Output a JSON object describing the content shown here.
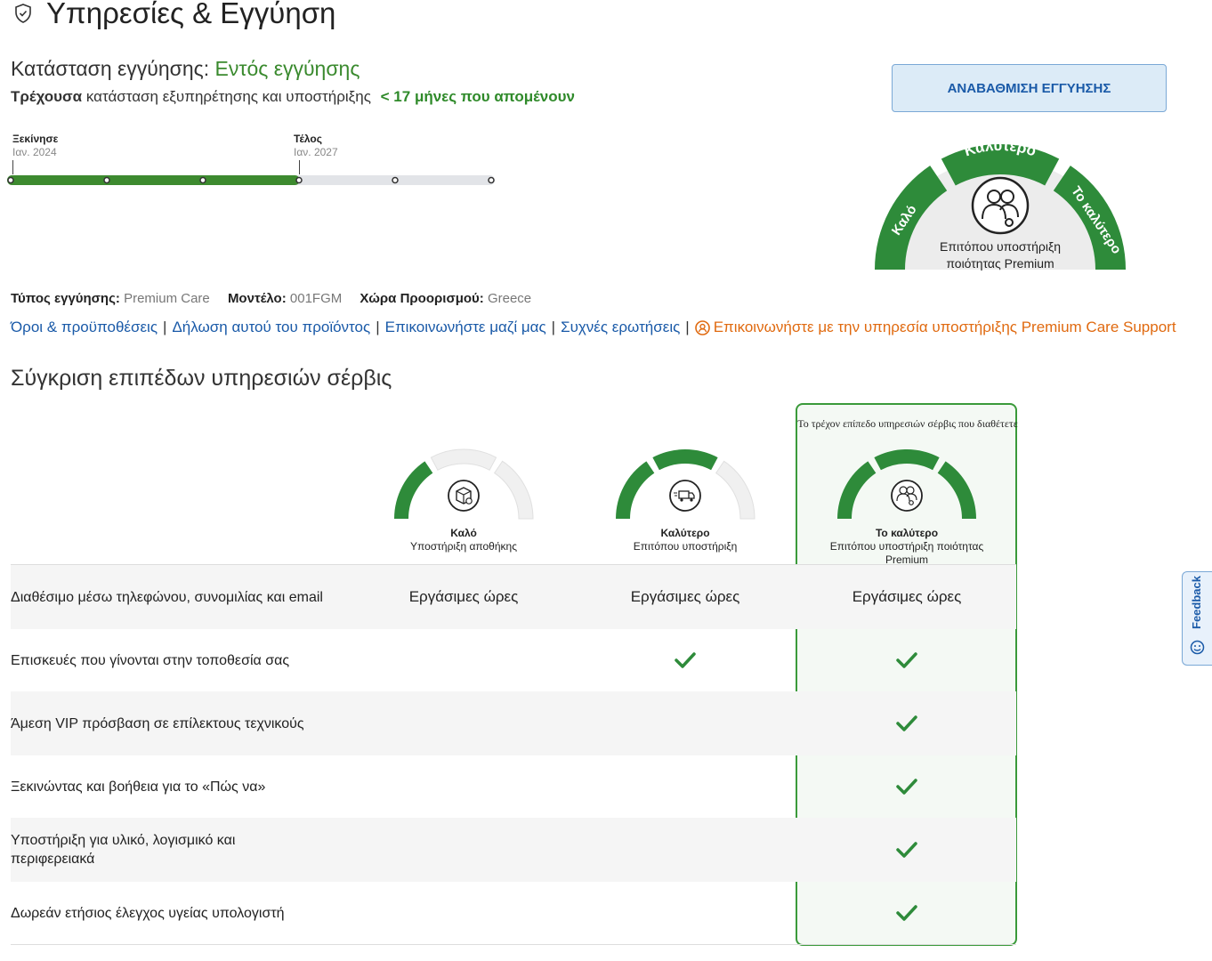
{
  "header": {
    "title": "Υπηρεσίες & Εγγύηση"
  },
  "status": {
    "label": "Κατάσταση εγγύησης:",
    "value": "Εντός εγγύησης",
    "sub_bold": "Τρέχουσα",
    "sub_rest": "κατάσταση εξυπηρέτησης και υποστήριξης",
    "remaining": "< 17 μήνες που απομένουν"
  },
  "upgrade_button": "ΑΝΑΒΑΘΜΙΣΗ ΕΓΓΥΗΣΗΣ",
  "timeline": {
    "start_label": "Ξεκίνησε",
    "start_date": "Ιαν. 2024",
    "end_label": "Τέλος",
    "end_date": "Ιαν. 2027",
    "progress_fraction": 0.6
  },
  "gauge": {
    "left": "Καλό",
    "top": "Καλύτερο",
    "right": "Το καλύτερο",
    "caption_line1": "Επιτόπου υποστήριξη",
    "caption_line2": "ποιότητας Premium",
    "active_level": 3
  },
  "info": {
    "type_label": "Τύπος εγγύησης:",
    "type_value": "Premium Care",
    "model_label": "Μοντέλο:",
    "model_value": "001FGM",
    "country_label": "Χώρα Προορισμού:",
    "country_value": "Greece"
  },
  "links": {
    "terms": "Όροι & προϋποθέσεις",
    "register": "Δήλωση αυτού του προϊόντος",
    "contact": "Επικοινωνήστε μαζί μας",
    "faq": "Συχνές ερωτήσεις",
    "premium_support": "Επικοινωνήστε με την υπηρεσία υποστήριξης Premium Care Support"
  },
  "comparison": {
    "title": "Σύγκριση επιπέδων υπηρεσιών σέρβις",
    "current_caption": "Το τρέχον επίπεδο υπηρεσιών σέρβις που διαθέτετε",
    "tiers": [
      {
        "name": "Καλό",
        "sub": "Υποστήριξη αποθήκης",
        "icon": "warehouse-box-icon",
        "level": 1
      },
      {
        "name": "Καλύτερο",
        "sub": "Επιτόπου υποστήριξη",
        "icon": "delivery-truck-icon",
        "level": 2
      },
      {
        "name": "Το καλύτερο",
        "sub": "Επιτόπου υποστήριξη ποιότητας Premium",
        "icon": "premium-support-icon",
        "level": 3
      }
    ],
    "rows": [
      {
        "label": "Διαθέσιμο μέσω τηλεφώνου, συνομιλίας και email",
        "cells": [
          "Εργάσιμες ώρες",
          "Εργάσιμες ώρες",
          "Εργάσιμες ώρες"
        ]
      },
      {
        "label": "Επισκευές που γίνονται στην τοποθεσία σας",
        "cells": [
          "",
          "check",
          "check"
        ]
      },
      {
        "label": "Άμεση VIP πρόσβαση σε επίλεκτους τεχνικούς",
        "cells": [
          "",
          "",
          "check"
        ]
      },
      {
        "label": "Ξεκινώντας και βοήθεια για το «Πώς να»",
        "cells": [
          "",
          "",
          "check"
        ]
      },
      {
        "label": "Υποστήριξη για υλικό, λογισμικό και περιφερειακά",
        "cells": [
          "",
          "",
          "check"
        ]
      },
      {
        "label": "Δωρεάν ετήσιος έλεγχος υγείας υπολογιστή",
        "cells": [
          "",
          "",
          "check"
        ]
      }
    ]
  },
  "feedback": "Feedback",
  "colors": {
    "green": "#2e8b3a",
    "blue": "#1a5aa8",
    "orange": "#e06a10"
  }
}
